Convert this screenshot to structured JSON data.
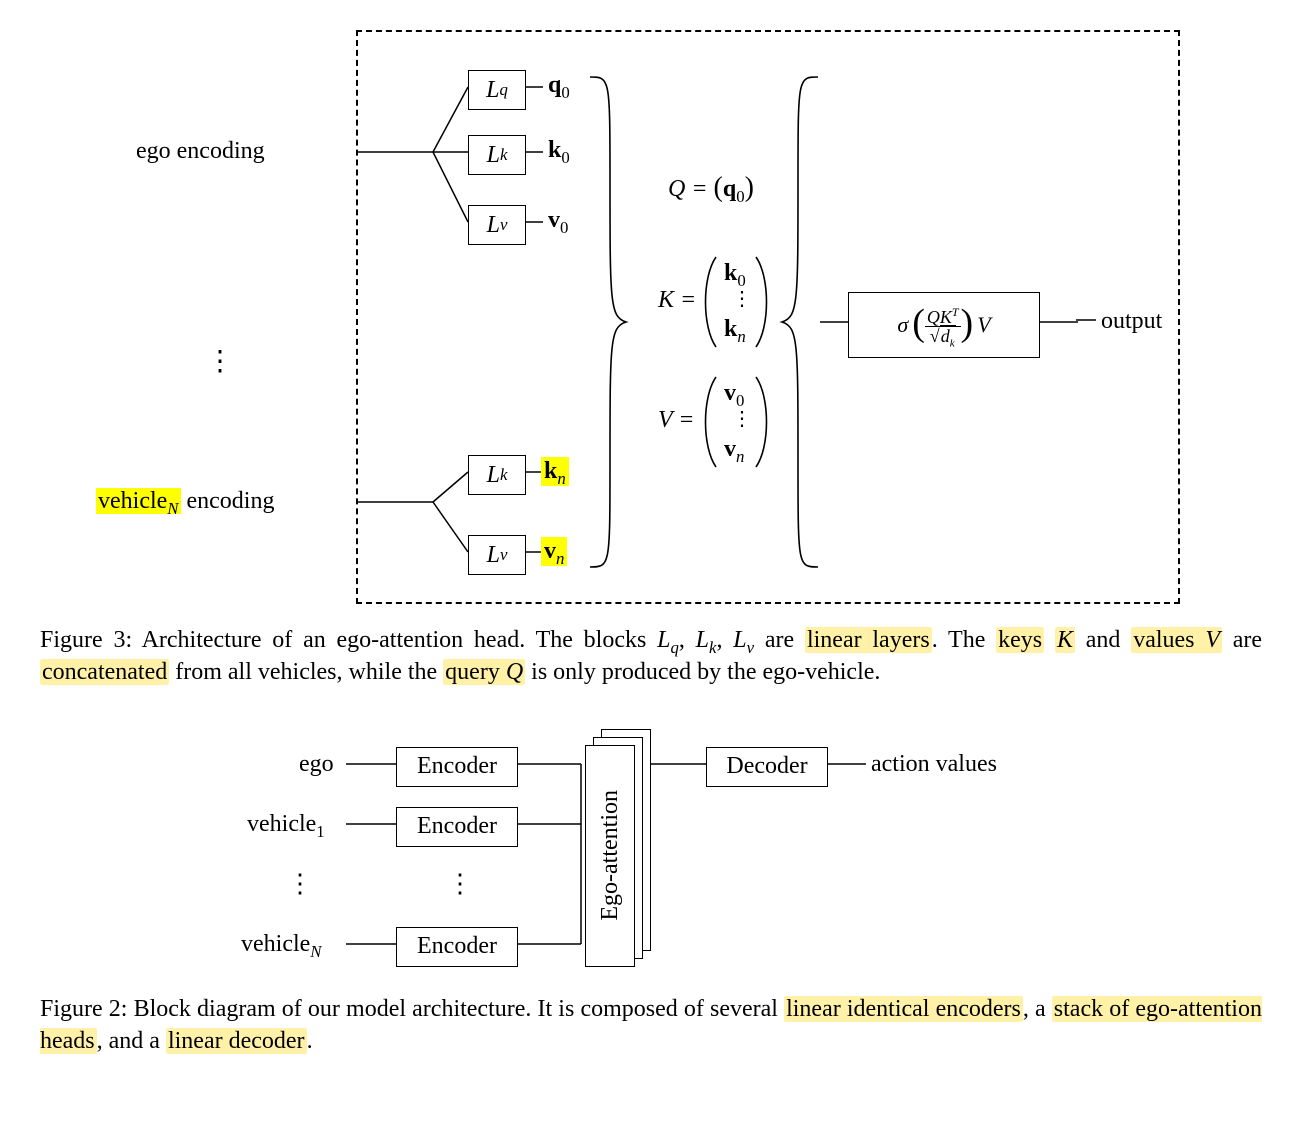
{
  "fig3": {
    "inputs": {
      "ego": "ego encoding",
      "vehN_pre": "vehicle",
      "vehN_post": " encoding",
      "vehN_sub": "N"
    },
    "blocks": {
      "Lq": "L",
      "Lq_sub": "q",
      "Lk": "L",
      "Lk_sub": "k",
      "Lv": "L",
      "Lv_sub": "v"
    },
    "outs": {
      "q0_b": "q",
      "q0_s": "0",
      "k0_b": "k",
      "k0_s": "0",
      "v0_b": "v",
      "v0_s": "0",
      "kn_b": "k",
      "kn_s": "n",
      "vn_b": "v",
      "vn_s": "n"
    },
    "eqs": {
      "Q_lhs": "Q = ",
      "Q_par_pre": "(",
      "Q_q": "q",
      "Q_qs": "0",
      "Q_par_post": ")",
      "K_lhs": "K = ",
      "V_lhs": "V = ",
      "vec_k0_b": "k",
      "vec_k0_s": "0",
      "vec_kn_b": "k",
      "vec_kn_s": "n",
      "vec_v0_b": "v",
      "vec_v0_s": "0",
      "vec_vn_b": "v",
      "vec_vn_s": "n"
    },
    "attn": {
      "sigma": "σ",
      "QK": "QK",
      "T": "T",
      "dk_d": "d",
      "dk_k": "k",
      "V": "V"
    },
    "output": "output",
    "vdots": "⋮",
    "caption_pre": "Figure 3: Architecture of an ego-attention head. The blocks ",
    "caption_LqLkLv": "L",
    "caption_q": "q",
    "caption_k": "k",
    "caption_v": "v",
    "caption_mid1": " are ",
    "caption_hl1": "linear layers",
    "caption_mid2": ". The ",
    "caption_hl2": "keys",
    "caption_mid3_a": " ",
    "caption_K": "K",
    "caption_mid3_b": " and ",
    "caption_hl3": "values ",
    "caption_V": "V",
    "caption_mid4": " are ",
    "caption_hl4": "concatenated",
    "caption_mid5": " from all vehicles, while the ",
    "caption_hl5": "query ",
    "caption_Q": "Q",
    "caption_mid6": " is only produced by the ego-vehicle."
  },
  "fig2": {
    "labels": {
      "ego": "ego",
      "veh1": "vehicle",
      "veh1_s": "1",
      "vehN": "vehicle",
      "vehN_s": "N",
      "encoder": "Encoder",
      "egoattn": "Ego-attention",
      "decoder": "Decoder",
      "out": "action values",
      "vdots": "⋮"
    },
    "caption_pre": "Figure 2: Block diagram of our model architecture. It is composed of several ",
    "caption_hl1": "linear identical encoders",
    "caption_mid1": ", a ",
    "caption_hl2": "stack of ego-attention heads",
    "caption_mid2": ", and a ",
    "caption_hl3": "linear decoder",
    "caption_end": "."
  }
}
